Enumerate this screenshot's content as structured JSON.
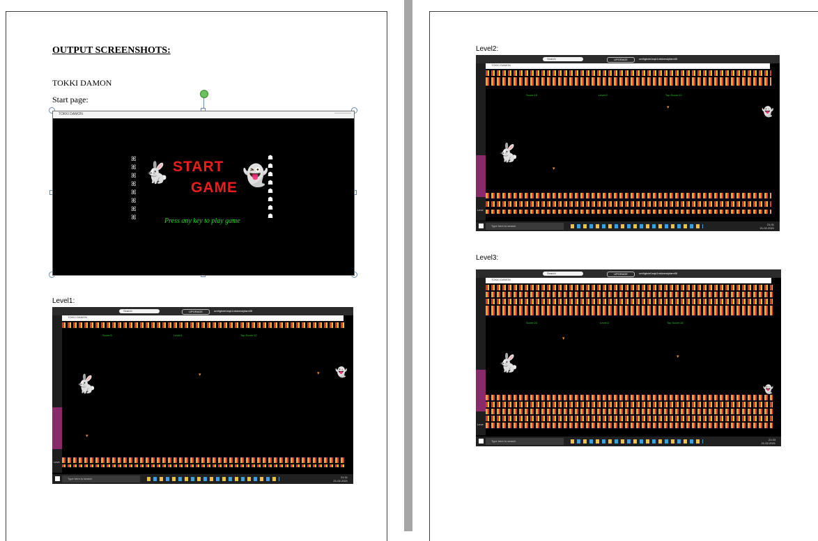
{
  "document": {
    "heading": "OUTPUT SCREENSHOTS:",
    "game_name": "TOKKI DAMON",
    "start_page_label": "Start page:",
    "level1_label": "Level1:",
    "level2_label": "Level2:",
    "level3_label": "Level3:"
  },
  "start_screen": {
    "window_title": "TOKKI DAMON",
    "start_word": "START",
    "game_word": "GAME",
    "prompt": "Press any key to play game",
    "title_color": "#ee1c1c",
    "prompt_color": "#22dd22"
  },
  "screens": {
    "common": {
      "search_text": "Search",
      "upgrade_text": "UPGRADE",
      "account_text": "om9ghde1eqk1mkkmwlyfam05",
      "game_window_title": "TOKKI DAMON",
      "taskbar_search": "Type here to search",
      "taskbar_lang": "ENG"
    },
    "level1": {
      "score": "Score:5",
      "level": "Level:1",
      "top_score": "Top Score:12",
      "time": "21:31",
      "date": "21-02-2021",
      "side_label": "Leve"
    },
    "level2": {
      "score": "Score:15",
      "level": "Level:2",
      "top_score": "Top Score:12",
      "time": "21:31",
      "date": "21-02-2021",
      "side_label": "Leve"
    },
    "level3": {
      "score": "Score:20",
      "level": "Level:3",
      "top_score": "Top Score:18",
      "time": "21:33",
      "date": "21-02-2021",
      "side_label": "Leve"
    }
  },
  "icons": {
    "bunny": "bunny-icon",
    "ghost": "ghost-icon",
    "carrot": "carrot-icon"
  }
}
